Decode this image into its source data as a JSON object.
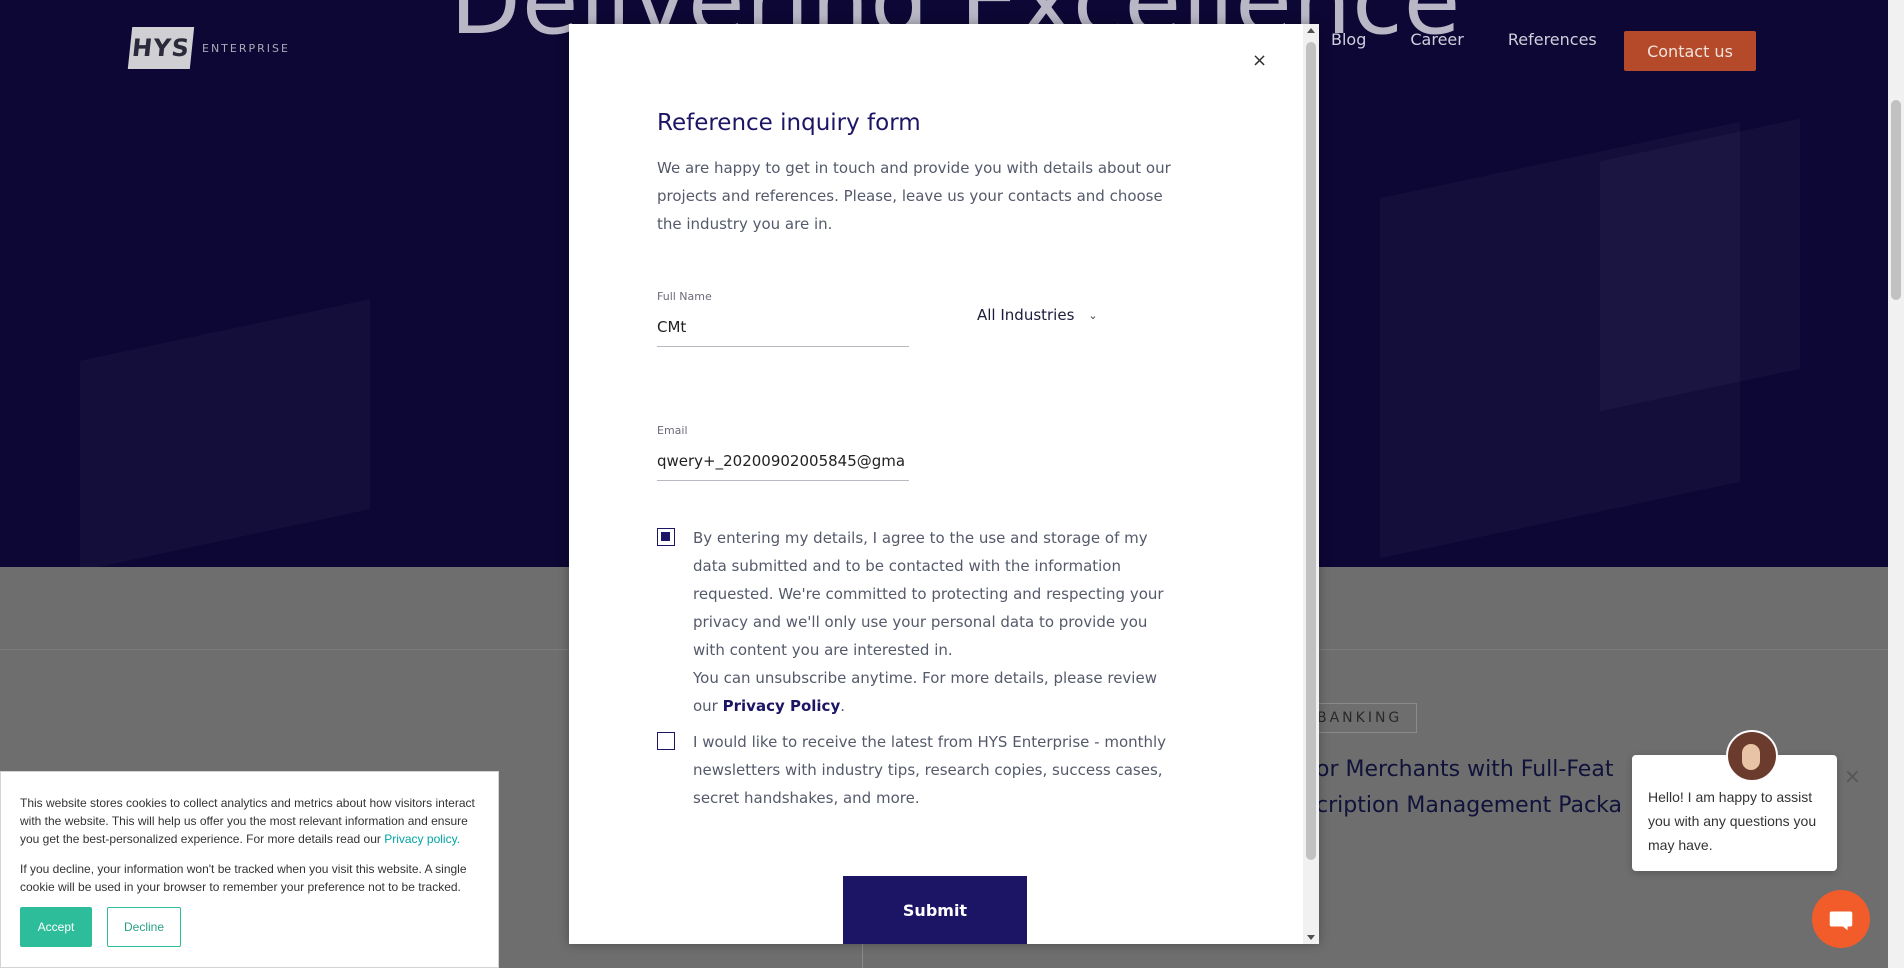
{
  "hero": {
    "headline": "Delivering Excellence",
    "logo_main": "HYS",
    "logo_sub": "ENTERPRISE"
  },
  "nav": {
    "items": [
      {
        "label": "Blog"
      },
      {
        "label": "Career"
      },
      {
        "label": "References"
      }
    ],
    "contact": "Contact us"
  },
  "modal": {
    "title": "Reference inquiry form",
    "description": "We are happy to get in touch and provide you with details about our projects and references. Please, leave us your contacts and choose the industry you are in.",
    "full_name_label": "Full Name",
    "full_name_value": "CMt",
    "industry_value": "All Industries",
    "email_label": "Email",
    "email_value": "qwery+_20200902005845@gma",
    "consent_text": "By entering my details, I agree to the use and storage of my data submitted and to be contacted with the information requested. We're committed to protecting and respecting your privacy and we'll only use your personal data to provide you with content you are interested in.",
    "unsubscribe_text": "You can unsubscribe anytime. For more details, please review our",
    "privacy_link": "Privacy Policy",
    "period": ".",
    "consent_checked": true,
    "newsletter_text": "I would like to receive the latest from HYS Enterprise - monthly newsletters with industry tips, research copies, success cases, secret handshakes, and more.",
    "newsletter_checked": false,
    "submit": "Submit",
    "close": "×"
  },
  "background_card": {
    "tag": "BANKING",
    "title_line1": "or Merchants with Full-Feat",
    "title_line2": "cription Management Packa"
  },
  "cookie": {
    "text1": "This website stores cookies to collect analytics and metrics about how visitors interact with the website. This will help us offer you the most relevant information and ensure you get the best-personalized experience. For more details read our",
    "privacy_link": "Privacy policy.",
    "text2": "If you decline, your information won't be tracked when you visit this website. A single cookie will be used in your browser to remember your preference not to be tracked.",
    "accept": "Accept",
    "decline": "Decline"
  },
  "chat": {
    "message": "Hello! I am happy to assist you with any questions you may have.",
    "close": "×"
  },
  "colors": {
    "primary": "#1c1464",
    "accent": "#b54a2a",
    "cookie_accent": "#2ebd9a",
    "chat_button": "#f25c2b"
  }
}
